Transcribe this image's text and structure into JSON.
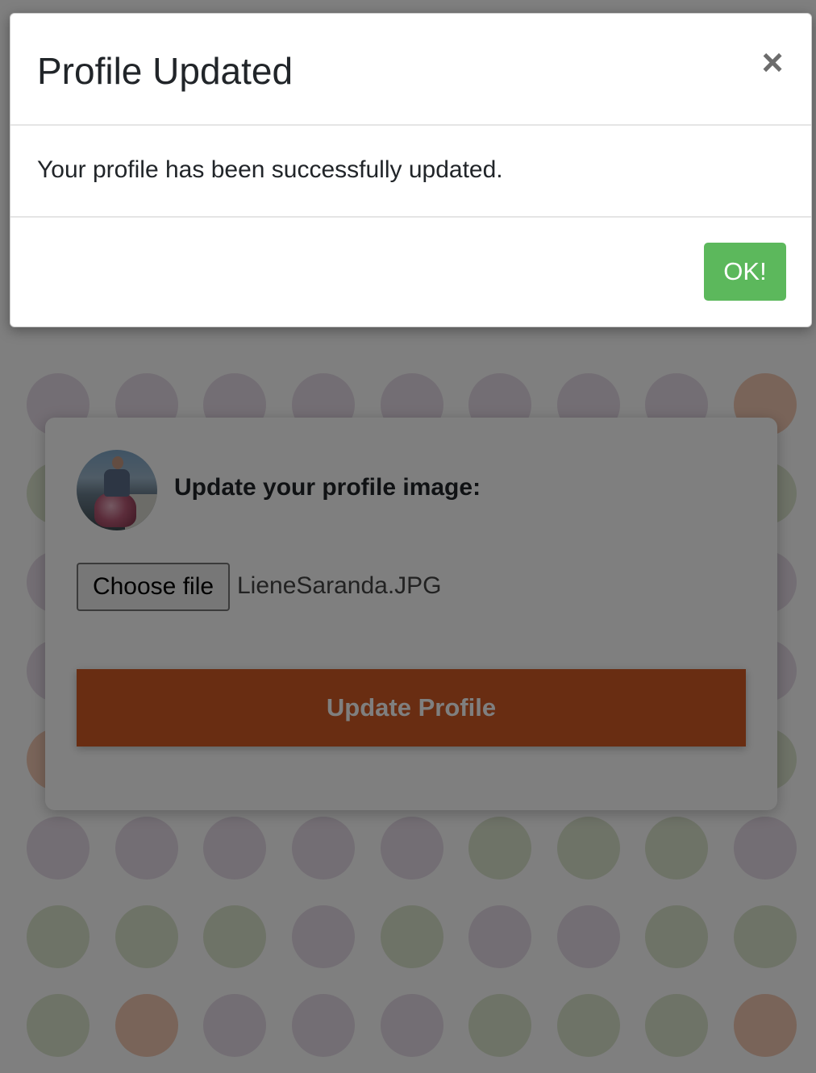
{
  "modal": {
    "title": "Profile Updated",
    "close_label": "×",
    "message": "Your profile has been successfully updated.",
    "ok_label": "OK!"
  },
  "profile_card": {
    "label": "Update your profile image:",
    "file_button_label": "Choose file",
    "file_name": "LieneSaranda.JPG",
    "submit_label": "Update Profile"
  },
  "colors": {
    "accent": "#d35a25",
    "ok_button": "#5cb85c",
    "dot_palette": [
      "#e7dce8",
      "#dde6cf",
      "#f3c9b3"
    ]
  },
  "icons": {
    "close": "close-icon"
  }
}
